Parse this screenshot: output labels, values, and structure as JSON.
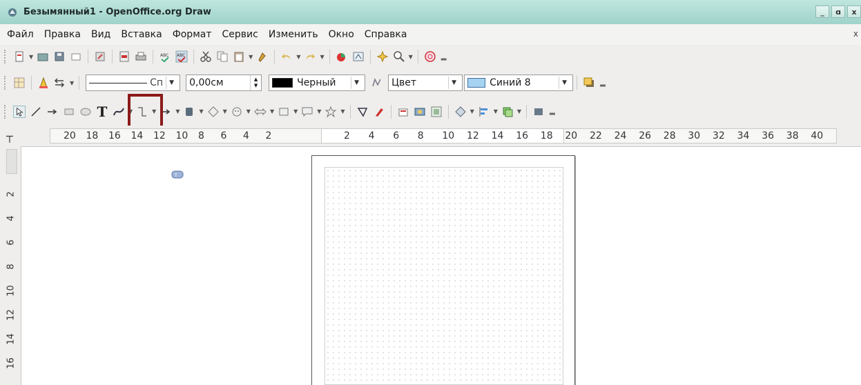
{
  "window": {
    "title": "Безымянный1 - OpenOffice.org Draw",
    "controls": [
      "_",
      "ɑ",
      "x"
    ]
  },
  "menu": {
    "items": [
      "Файл",
      "Правка",
      "Вид",
      "Вставка",
      "Формат",
      "Сервис",
      "Изменить",
      "Окно",
      "Справка"
    ],
    "close": "x"
  },
  "line_toolbar": {
    "line_style_value": "Сп",
    "line_width_value": "0,00см",
    "line_color_value": "Черный",
    "area_style_value": "Цвет",
    "area_fill_value": "Синий 8"
  },
  "colors": {
    "line_color_swatch": "#000000",
    "area_fill_swatch": "#99ccff",
    "highlight_border": "#8b1a1a",
    "titlebar": "#a9d8cf"
  },
  "drawing_toolbar": {
    "text_tool_label": "T"
  },
  "ruler": {
    "horizontal_left": [
      "20",
      "18",
      "16",
      "14",
      "12",
      "10",
      "8",
      "6",
      "4",
      "2"
    ],
    "horizontal_right": [
      "2",
      "4",
      "6",
      "8",
      "10",
      "12",
      "14",
      "16",
      "18",
      "20",
      "22",
      "24",
      "26",
      "28",
      "30",
      "32",
      "34",
      "36",
      "38",
      "40"
    ],
    "vertical": [
      "2",
      "4",
      "6",
      "8",
      "10",
      "12",
      "14",
      "16"
    ]
  }
}
